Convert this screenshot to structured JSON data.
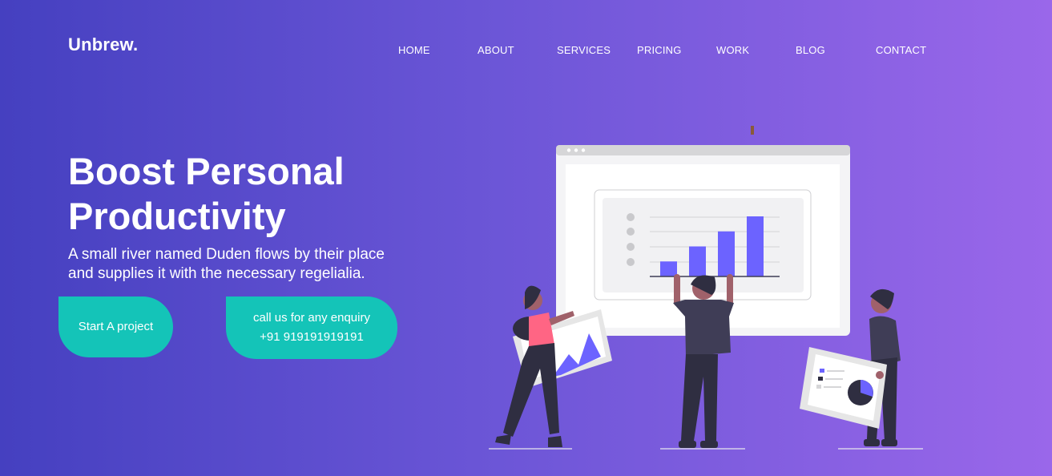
{
  "brand": {
    "logo": "Unbrew."
  },
  "nav": {
    "items": [
      {
        "label": "HOME"
      },
      {
        "label": "ABOUT"
      },
      {
        "label": "SERVICES"
      },
      {
        "label": "PRICING"
      },
      {
        "label": "WORK"
      },
      {
        "label": "BLOG"
      },
      {
        "label": "CONTACT"
      }
    ]
  },
  "hero": {
    "title_line1": "Boost Personal",
    "title_line2": "Productivity",
    "subtitle_line1": "A small river named Duden flows by their place",
    "subtitle_line2": "and supplies it with the necessary regelialia.",
    "start_button": "Start A project",
    "call_line1": "call us for any enquiry",
    "call_line2": "+91 919191919191"
  },
  "colors": {
    "gradient_start": "#4540c0",
    "gradient_end": "#9a67ea",
    "accent": "#14c4b8",
    "illustration_bar": "#6c63ff",
    "illustration_shirt": "#ff6584"
  },
  "illustration": {
    "icon": "presentation-chart-illustration",
    "bar_values": [
      1,
      2,
      3,
      4
    ]
  }
}
